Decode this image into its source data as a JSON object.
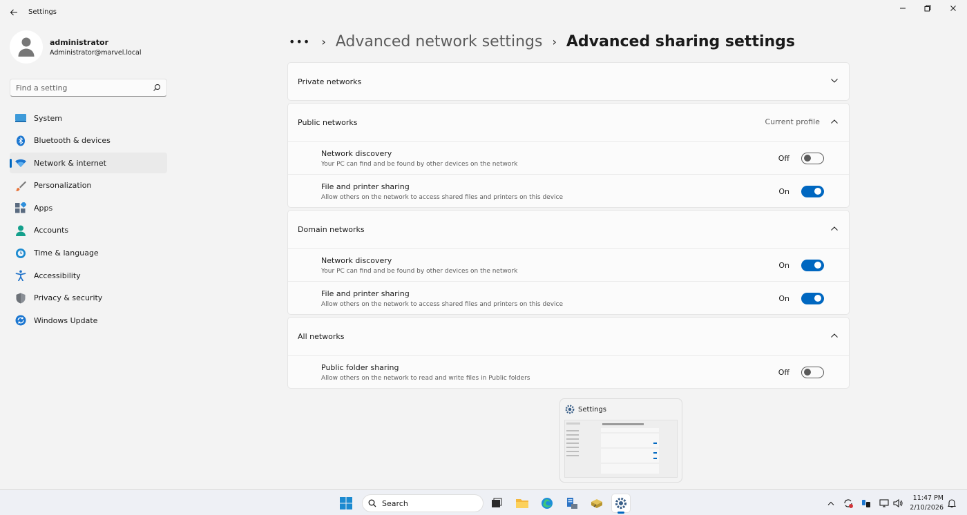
{
  "window": {
    "title": "Settings"
  },
  "user": {
    "name": "administrator",
    "email": "Administrator@marvel.local"
  },
  "search": {
    "placeholder": "Find a setting"
  },
  "nav": [
    {
      "label": "System",
      "icon": "system-icon"
    },
    {
      "label": "Bluetooth & devices",
      "icon": "bluetooth-icon"
    },
    {
      "label": "Network & internet",
      "icon": "wifi-icon",
      "active": true
    },
    {
      "label": "Personalization",
      "icon": "brush-icon"
    },
    {
      "label": "Apps",
      "icon": "apps-icon"
    },
    {
      "label": "Accounts",
      "icon": "person-icon"
    },
    {
      "label": "Time & language",
      "icon": "globe-clock-icon"
    },
    {
      "label": "Accessibility",
      "icon": "accessibility-icon"
    },
    {
      "label": "Privacy & security",
      "icon": "shield-icon"
    },
    {
      "label": "Windows Update",
      "icon": "update-icon"
    }
  ],
  "breadcrumb": {
    "dots": "•••",
    "parent": "Advanced network settings",
    "current": "Advanced sharing settings"
  },
  "sections": {
    "private": {
      "title": "Private networks"
    },
    "public": {
      "title": "Public networks",
      "tag": "Current profile",
      "settings": [
        {
          "title": "Network discovery",
          "desc": "Your PC can find and be found by other devices on the network",
          "state": "Off"
        },
        {
          "title": "File and printer sharing",
          "desc": "Allow others on the network to access shared files and printers on this device",
          "state": "On"
        }
      ]
    },
    "domain": {
      "title": "Domain networks",
      "settings": [
        {
          "title": "Network discovery",
          "desc": "Your PC can find and be found by other devices on the network",
          "state": "On"
        },
        {
          "title": "File and printer sharing",
          "desc": "Allow others on the network to access shared files and printers on this device",
          "state": "On"
        }
      ]
    },
    "all": {
      "title": "All networks",
      "settings": [
        {
          "title": "Public folder sharing",
          "desc": "Allow others on the network to read and write files in Public folders",
          "state": "Off"
        }
      ]
    }
  },
  "thumbnail": {
    "title": "Settings"
  },
  "taskbar": {
    "search_label": "Search",
    "time": "11:47 PM",
    "date": "2/10/2026"
  },
  "colors": {
    "accent": "#0067c0",
    "background": "#f3f3f3",
    "card": "#fbfbfb"
  }
}
